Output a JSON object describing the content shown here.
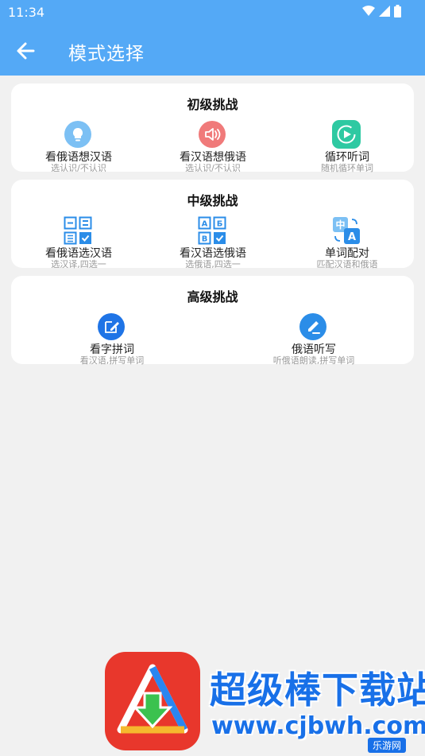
{
  "status": {
    "time": "11:34"
  },
  "appbar": {
    "title": "模式选择"
  },
  "sections": [
    {
      "title": "初级挑战",
      "items": [
        {
          "label": "看俄语想汉语",
          "sub": "选认识/不认识",
          "icon": "lightbulb-icon",
          "color": "#7cc0f4"
        },
        {
          "label": "看汉语想俄语",
          "sub": "选认识/不认识",
          "icon": "speaker-icon",
          "color": "#f07a7a"
        },
        {
          "label": "循环听词",
          "sub": "随机循环单词",
          "icon": "play-cycle-icon",
          "color": "#2ec9a2"
        }
      ]
    },
    {
      "title": "中级挑战",
      "items": [
        {
          "label": "看俄语选汉语",
          "sub": "选汉译,四选一",
          "icon": "choice-grid-icon",
          "color": "#2b8de8"
        },
        {
          "label": "看汉语选俄语",
          "sub": "选俄语,四选一",
          "icon": "letter-grid-icon",
          "color": "#2b8de8"
        },
        {
          "label": "单词配对",
          "sub": "匹配汉语和俄语",
          "icon": "translate-icon",
          "color": "#3a96ec"
        }
      ]
    },
    {
      "title": "高级挑战",
      "items": [
        {
          "label": "看字拼词",
          "sub": "看汉语,拼写单词",
          "icon": "edit-icon",
          "color": "#1f74e6"
        },
        {
          "label": "俄语听写",
          "sub": "听俄语朗读,拼写单词",
          "icon": "pen-write-icon",
          "color": "#2b8de8"
        }
      ]
    }
  ],
  "watermark": {
    "text": "超级棒下载站",
    "url": "www.cjbwh.com",
    "badge": "乐游网"
  }
}
